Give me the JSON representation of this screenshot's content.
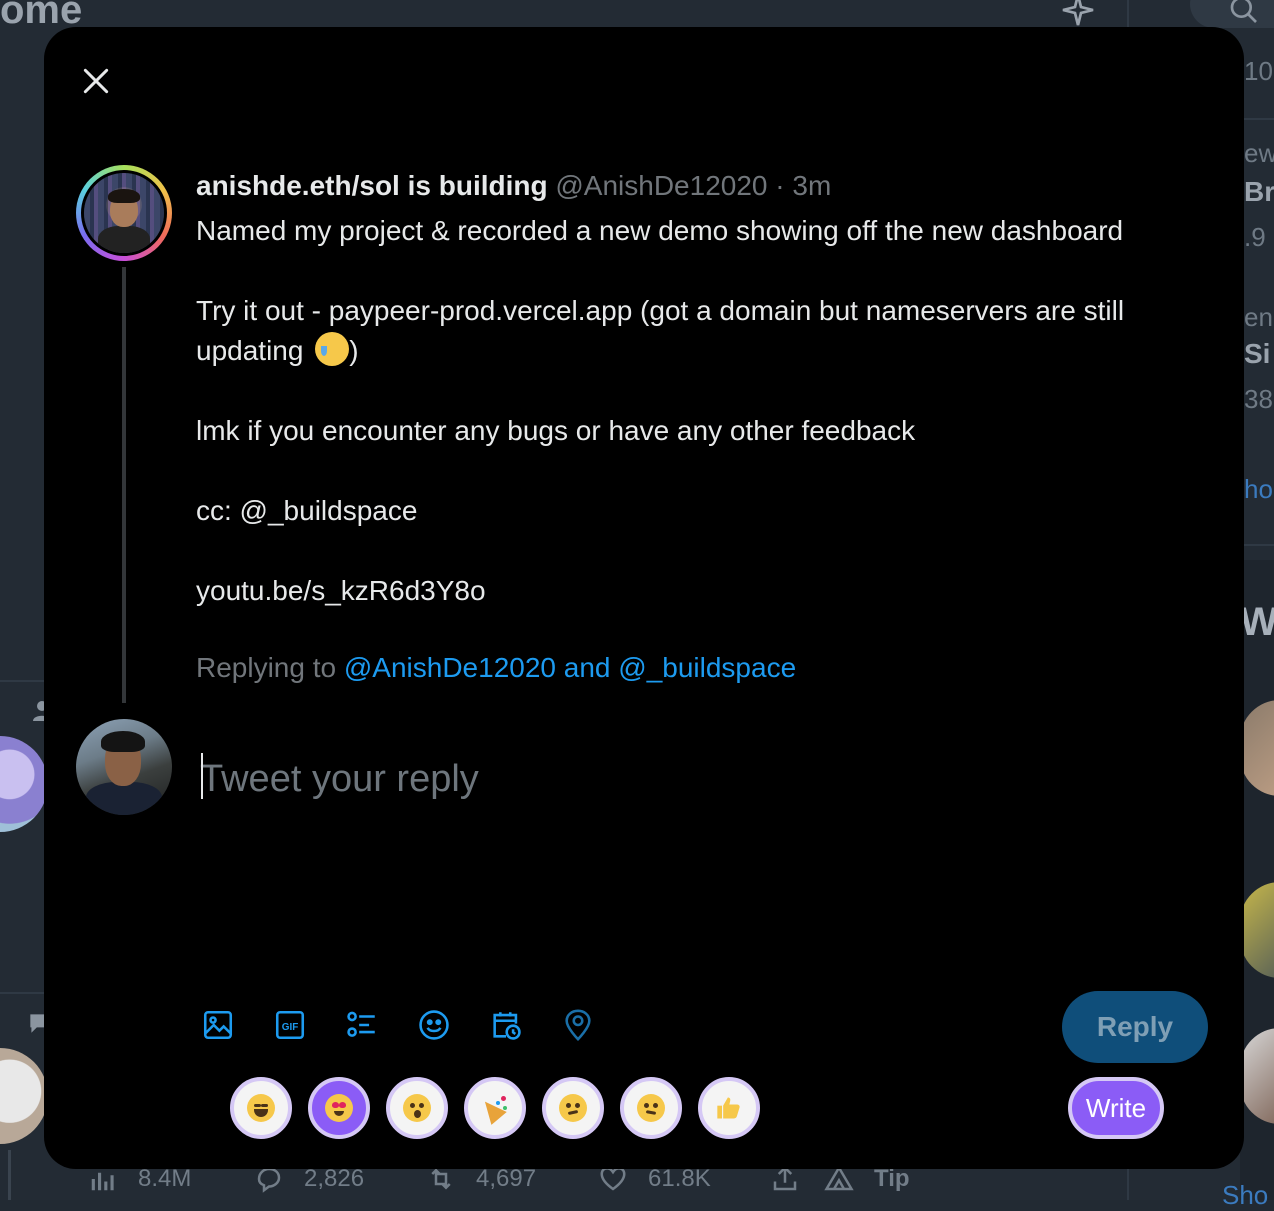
{
  "background": {
    "header_title": "ome",
    "right_column_snippets": [
      "10",
      "ew",
      "Br",
      ".9",
      "en",
      "Si",
      "38",
      "ho",
      "Wh"
    ],
    "stats": {
      "views": "8.4M",
      "replies": "2,826",
      "retweets": "4,697",
      "likes": "61.8K",
      "tip_label": "Tip"
    },
    "bottom_right_snippet": "Sho"
  },
  "modal": {
    "tweet": {
      "author_name": "anishde.eth/sol is building",
      "author_handle": "@AnishDe12020",
      "separator": "·",
      "time": "3m",
      "lines": [
        "Named my project & recorded a new demo showing off the new dashboard",
        "",
        "Try it out - paypeer-prod.vercel.app (got a domain but nameservers are still",
        "updating",
        "",
        "lmk if you encounter any bugs or have any other feedback",
        "",
        "cc: @_buildspace",
        "",
        "youtu.be/s_kzR6d3Y8o"
      ],
      "line4_suffix": ")"
    },
    "replying": {
      "label": "Replying to",
      "mentions": "@AnishDe12020 and @_buildspace"
    },
    "reply_input": {
      "placeholder": "Tweet your reply",
      "value": ""
    },
    "toolbar_icons": [
      "image-icon",
      "gif-icon",
      "poll-icon",
      "emoji-icon",
      "schedule-icon",
      "location-icon"
    ],
    "reply_button": "Reply",
    "reactions": [
      "joy",
      "heart-eyes",
      "open-mouth",
      "party-popper",
      "thinking",
      "confused",
      "thumbs-up"
    ],
    "write_button": "Write",
    "colors": {
      "accent": "#1d9bf0",
      "reply_button_disabled": "#0f4e7a",
      "purple": "#8b5cf6"
    }
  }
}
